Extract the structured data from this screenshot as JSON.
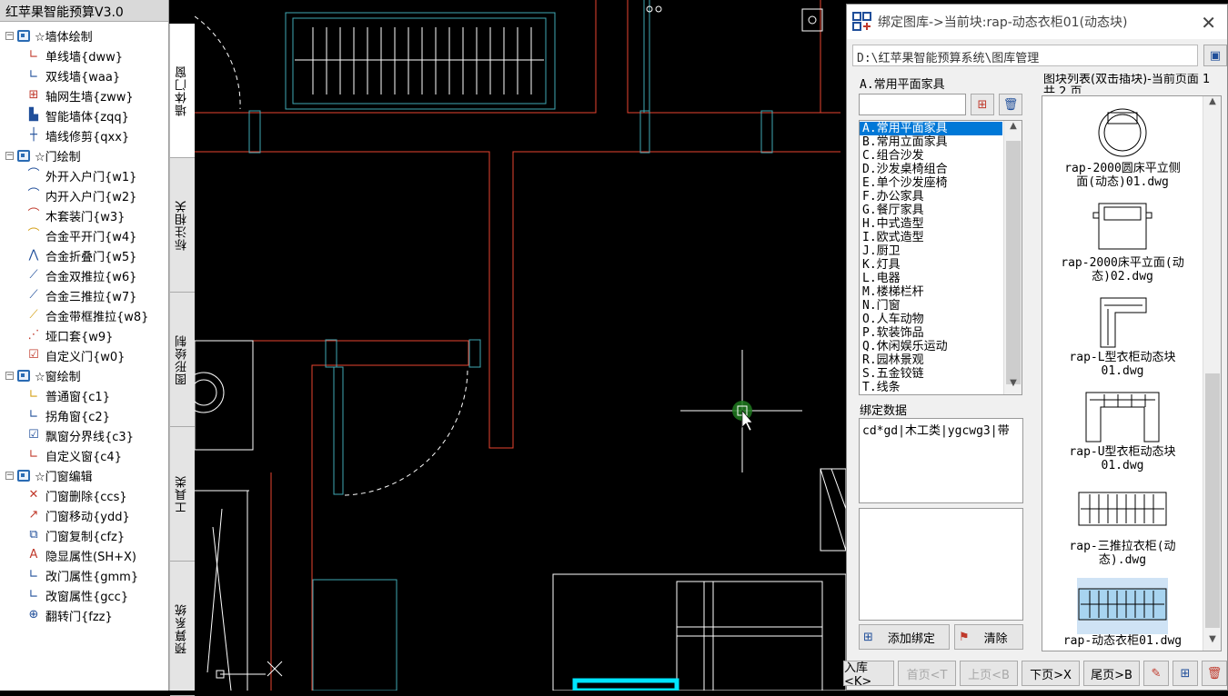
{
  "app": {
    "title": "红苹果智能预算V3.0"
  },
  "tree": {
    "groups": [
      {
        "label": "☆墙体绘制",
        "items": [
          {
            "label": "单线墙{dww}",
            "icon": "single-wall-icon",
            "glyph": "∟",
            "color": "#c0392b"
          },
          {
            "label": "双线墙{waa}",
            "icon": "double-wall-icon",
            "glyph": "∟",
            "color": "#1f4e9a"
          },
          {
            "label": "轴网生墙{zww}",
            "icon": "grid-wall-icon",
            "glyph": "⊞",
            "color": "#c0392b"
          },
          {
            "label": "智能墙体{zqq}",
            "icon": "smart-wall-icon",
            "glyph": "▙",
            "color": "#1f4e9a"
          },
          {
            "label": "墙线修剪{qxx}",
            "icon": "trim-wall-icon",
            "glyph": "┼",
            "color": "#1f4e9a"
          }
        ]
      },
      {
        "label": "☆门绘制",
        "items": [
          {
            "label": "外开入户门{w1}",
            "icon": "outward-door-icon",
            "glyph": "⌒",
            "color": "#1f4e9a"
          },
          {
            "label": "内开入户门{w2}",
            "icon": "inward-door-icon",
            "glyph": "⌒",
            "color": "#1f4e9a"
          },
          {
            "label": "木套装门{w3}",
            "icon": "wood-door-icon",
            "glyph": "⌒",
            "color": "#c0392b"
          },
          {
            "label": "合金平开门{w4}",
            "icon": "alloy-swing-door-icon",
            "glyph": "⌒",
            "color": "#d4a017"
          },
          {
            "label": "合金折叠门{w5}",
            "icon": "alloy-fold-door-icon",
            "glyph": "⋀",
            "color": "#1f4e9a"
          },
          {
            "label": "合金双推拉{w6}",
            "icon": "alloy-double-slide-icon",
            "glyph": "⟋",
            "color": "#1f4e9a"
          },
          {
            "label": "合金三推拉{w7}",
            "icon": "alloy-triple-slide-icon",
            "glyph": "⟋",
            "color": "#1f4e9a"
          },
          {
            "label": "合金带框推拉{w8}",
            "icon": "alloy-frame-slide-icon",
            "glyph": "⟋",
            "color": "#d4a017"
          },
          {
            "label": "垭口套{w9}",
            "icon": "opening-frame-icon",
            "glyph": "⋰",
            "color": "#c0392b"
          },
          {
            "label": "自定义门{w0}",
            "icon": "custom-door-icon",
            "glyph": "☑",
            "color": "#c0392b"
          }
        ]
      },
      {
        "label": "☆窗绘制",
        "items": [
          {
            "label": "普通窗{c1}",
            "icon": "window-icon",
            "glyph": "∟",
            "color": "#d4a017"
          },
          {
            "label": "拐角窗{c2}",
            "icon": "corner-window-icon",
            "glyph": "∟",
            "color": "#1f4e9a"
          },
          {
            "label": "飘窗分界线{c3}",
            "icon": "bay-window-icon",
            "glyph": "☑",
            "color": "#1f4e9a"
          },
          {
            "label": "自定义窗{c4}",
            "icon": "custom-window-icon",
            "glyph": "∟",
            "color": "#c0392b"
          }
        ]
      },
      {
        "label": "☆门窗编辑",
        "items": [
          {
            "label": "门窗删除{ccs}",
            "icon": "delete-opening-icon",
            "glyph": "✕",
            "color": "#c0392b"
          },
          {
            "label": "门窗移动{ydd}",
            "icon": "move-opening-icon",
            "glyph": "↗",
            "color": "#c0392b"
          },
          {
            "label": "门窗复制{cfz}",
            "icon": "copy-opening-icon",
            "glyph": "⧉",
            "color": "#1f4e9a"
          },
          {
            "label": "隐显属性(SH+X)",
            "icon": "toggle-attr-icon",
            "glyph": "A",
            "color": "#c0392b"
          },
          {
            "label": "改门属性{gmm}",
            "icon": "edit-door-attr-icon",
            "glyph": "∟",
            "color": "#1f4e9a"
          },
          {
            "label": "改窗属性{gcc}",
            "icon": "edit-window-attr-icon",
            "glyph": "∟",
            "color": "#1f4e9a"
          },
          {
            "label": "翻转门{fzz}",
            "icon": "flip-door-icon",
            "glyph": "⊕",
            "color": "#1f4e9a"
          }
        ]
      }
    ]
  },
  "vtabs": [
    "墙体门窗",
    "标注相关",
    "图形绘制",
    "工具类",
    "预算系统"
  ],
  "dialog": {
    "title": "绑定图库->当前块:rap-动态衣柜01(动态块)",
    "path": "D:\\红苹果智能预算系统\\图库管理",
    "category_label": "A.常用平面家具",
    "search_value": "",
    "categories": [
      "A.常用平面家具",
      "B.常用立面家具",
      "C.组合沙发",
      "D.沙发桌椅组合",
      "E.单个沙发座椅",
      "F.办公家具",
      "G.餐厅家具",
      "H.中式造型",
      "I.欧式造型",
      "J.厨卫",
      "K.灯具",
      "L.电器",
      "M.楼梯栏杆",
      "N.门窗",
      "O.人车动物",
      "P.软装饰品",
      "Q.休闲娱乐运动",
      "R.园林景观",
      "S.五金铰链",
      "T.线条"
    ],
    "selected_category": 0,
    "bind_label": "绑定数据",
    "bind_text": "cd*gd|木工类|ygcwg3|带",
    "add_bind_label": "添加绑定",
    "clear_label": "清除",
    "block_list_label": "图块列表(双击插块)-当前页面 1 共 2 页",
    "blocks": [
      {
        "name_line1": "rap-2000圆床平立侧",
        "name_line2": "面(动态)01.dwg"
      },
      {
        "name_line1": "rap-2000床平立面(动",
        "name_line2": "态)02.dwg"
      },
      {
        "name_line1": "rap-L型衣柜动态块",
        "name_line2": "01.dwg"
      },
      {
        "name_line1": "rap-U型衣柜动态块",
        "name_line2": "01.dwg"
      },
      {
        "name_line1": "rap-三推拉衣柜(动",
        "name_line2": "态).dwg"
      },
      {
        "name_line1": "rap-动态衣柜01.dwg",
        "name_line2": ""
      }
    ],
    "pager": {
      "import": "入库<K>",
      "first": "首页<T",
      "prev": "上页<B",
      "next": "下页>X",
      "last": "尾页>B"
    }
  },
  "colors": {
    "wall_red": "#e8432f",
    "line_cyan": "#3fa9b5",
    "line_white": "#ffffff",
    "highlight_cyan": "#00e5ff",
    "accent_blue": "#0078d7"
  }
}
